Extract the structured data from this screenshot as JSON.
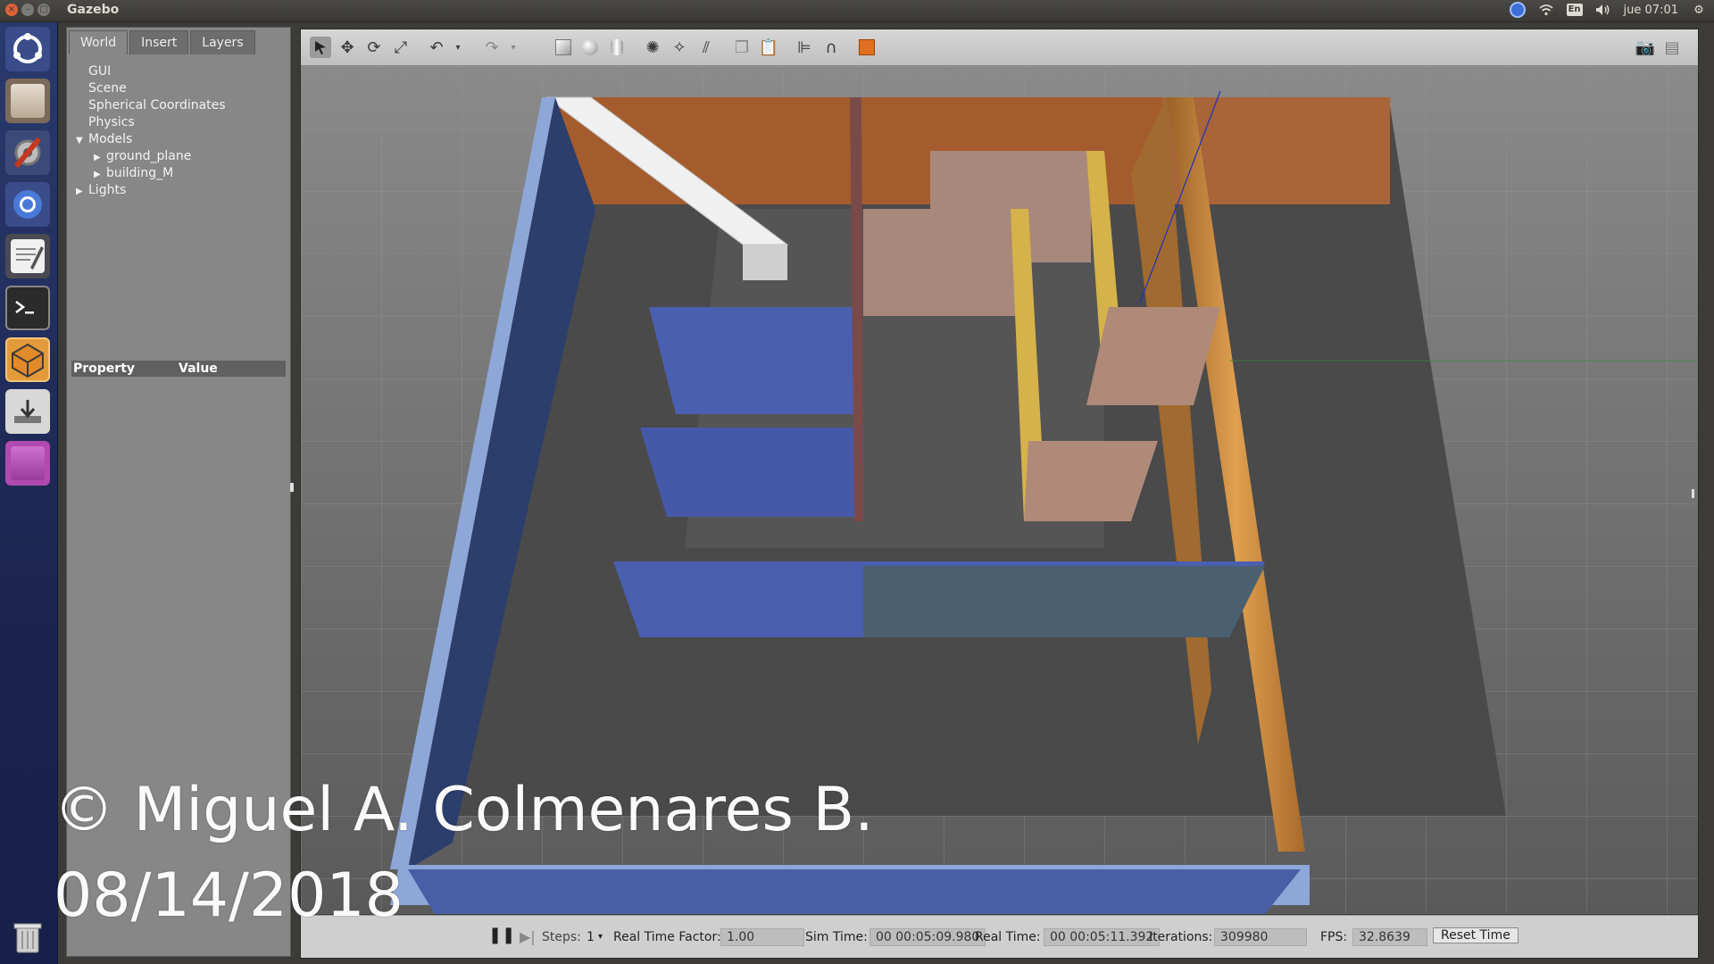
{
  "window": {
    "title": "Gazebo"
  },
  "tray": {
    "language": "En",
    "clock": "jue 07:01"
  },
  "sidebar": {
    "tabs": [
      {
        "label": "World",
        "active": true
      },
      {
        "label": "Insert",
        "active": false
      },
      {
        "label": "Layers",
        "active": false
      }
    ],
    "tree": [
      {
        "label": "GUI",
        "level": 0,
        "expander": ""
      },
      {
        "label": "Scene",
        "level": 0,
        "expander": ""
      },
      {
        "label": "Spherical Coordinates",
        "level": 0,
        "expander": ""
      },
      {
        "label": "Physics",
        "level": 0,
        "expander": ""
      },
      {
        "label": "Models",
        "level": 0,
        "expander": "expanded"
      },
      {
        "label": "ground_plane",
        "level": 1,
        "expander": "collapsed"
      },
      {
        "label": "building_M",
        "level": 1,
        "expander": "collapsed"
      },
      {
        "label": "Lights",
        "level": 0,
        "expander": "collapsed"
      }
    ],
    "property_header": {
      "property": "Property",
      "value": "Value"
    }
  },
  "toolbar": {
    "icons": [
      "select-mode-icon",
      "translate-mode-icon",
      "rotate-mode-icon",
      "scale-mode-icon",
      "undo-icon",
      "undo-history-icon",
      "redo-icon",
      "redo-history-icon",
      "box-shape-icon",
      "sphere-shape-icon",
      "cylinder-shape-icon",
      "point-light-icon",
      "spot-light-icon",
      "directional-light-icon",
      "copy-icon",
      "paste-icon",
      "align-icon",
      "snap-icon",
      "view-angle-icon",
      "screenshot-icon",
      "log-icon"
    ]
  },
  "status": {
    "steps_label": "Steps:",
    "steps_value": "1",
    "rtf_label": "Real Time Factor:",
    "rtf_value": "1.00",
    "sim_time_label": "Sim Time:",
    "sim_time_value": "00 00:05:09.980",
    "real_time_label": "Real Time:",
    "real_time_value": "00 00:05:11.392",
    "iterations_label": "Iterations:",
    "iterations_value": "309980",
    "fps_label": "FPS:",
    "fps_value": "32.8639",
    "reset_label": "Reset Time"
  },
  "watermark": {
    "line1": "© Miguel A. Colmenares B.",
    "line2": "08/14/2018"
  },
  "colors": {
    "accent": "#e0613a",
    "blue_wall": "#4b5fb0",
    "orange_wall": "#b06a3c",
    "yellow_wall": "#d4b04a",
    "beige_wall": "#b08a78",
    "ground": "#6a6a6a"
  }
}
